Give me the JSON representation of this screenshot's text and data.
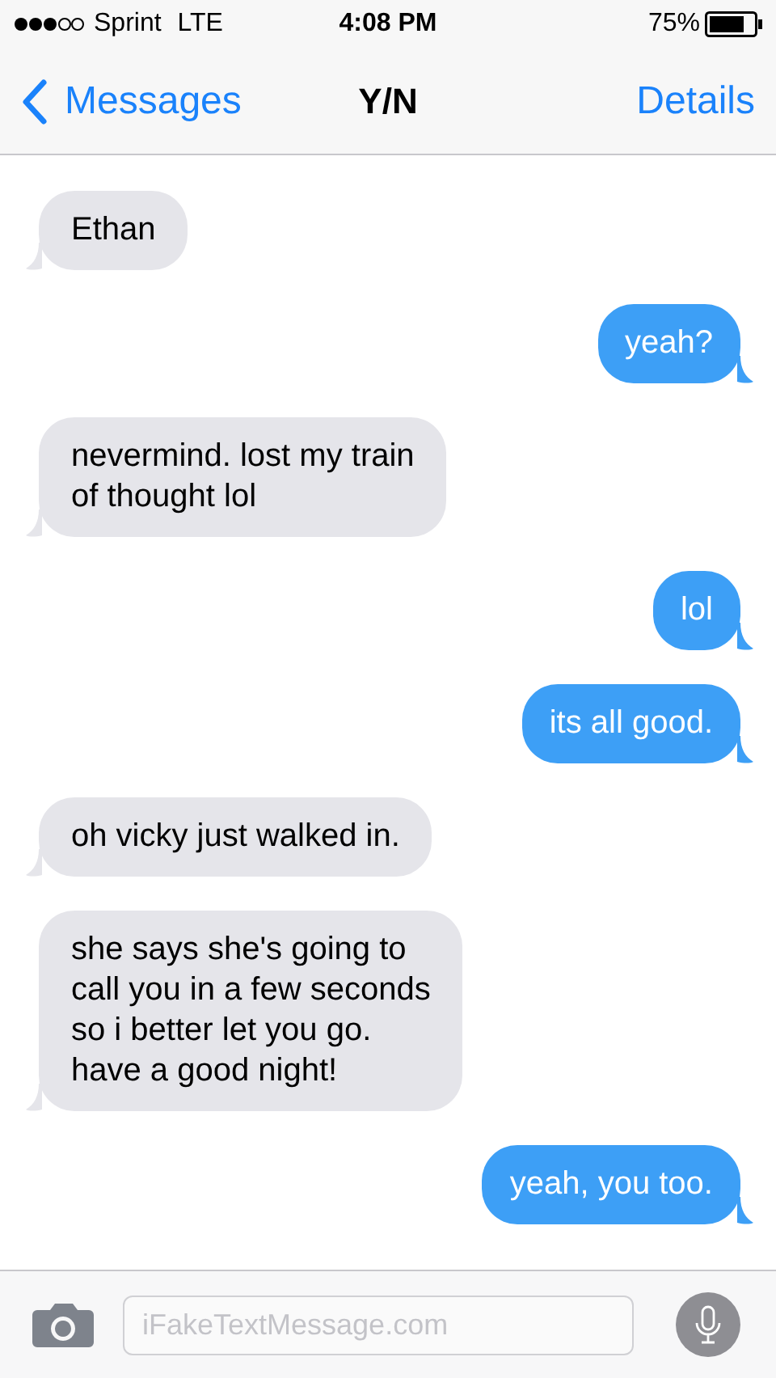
{
  "status_bar": {
    "carrier": "Sprint",
    "network": "LTE",
    "time": "4:08 PM",
    "battery": "75%"
  },
  "nav_bar": {
    "back": "Messages",
    "title": "Y/N",
    "action": "Details"
  },
  "messages": [
    {
      "kind": "received",
      "text": "Ethan"
    },
    {
      "kind": "sent",
      "text": "yeah?"
    },
    {
      "kind": "received",
      "text": "nevermind. lost my train\nof thought lol"
    },
    {
      "kind": "sent",
      "text": "lol"
    },
    {
      "kind": "sent",
      "text": "its all good."
    },
    {
      "kind": "received",
      "text": "oh vicky just walked in."
    },
    {
      "kind": "received",
      "text": "she says she's going to\ncall you in a few seconds\nso i better let you go.\nhave a good night!"
    },
    {
      "kind": "sent",
      "text": "yeah, you too."
    }
  ],
  "composer": {
    "placeholder": "iFakeTextMessage.com"
  }
}
